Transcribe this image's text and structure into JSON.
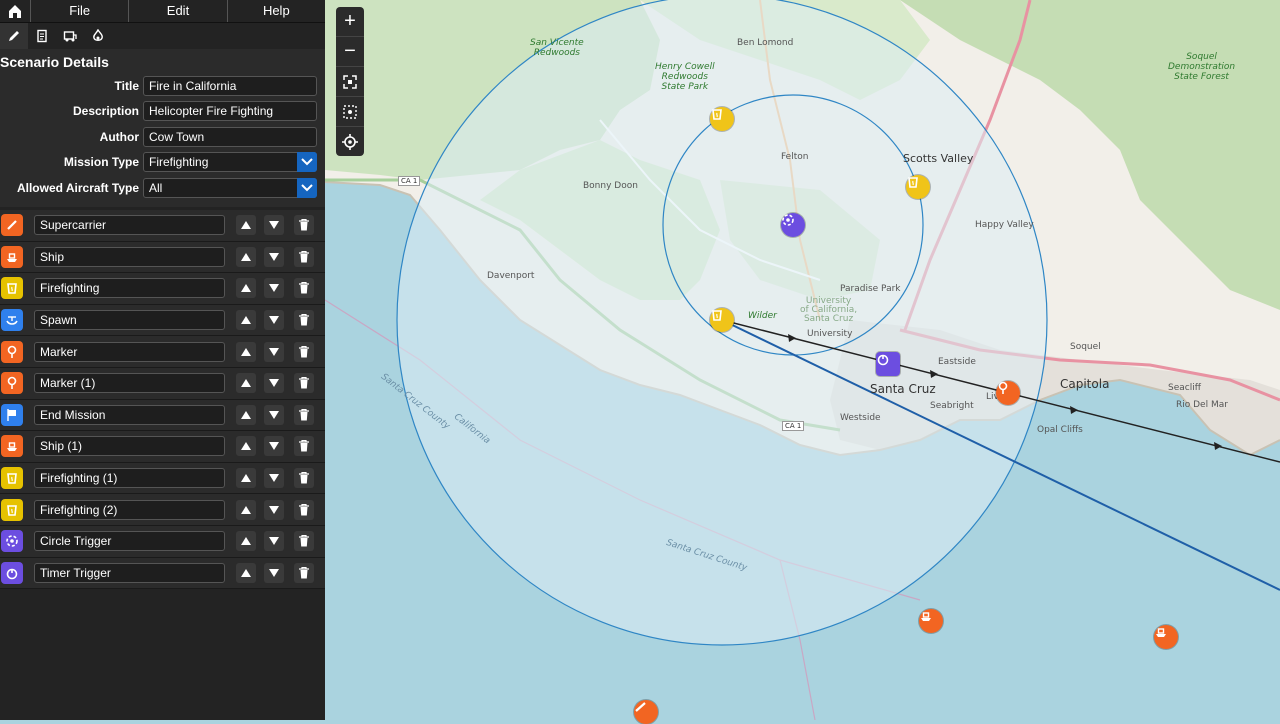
{
  "menubar": {
    "items": [
      "File",
      "Edit",
      "Help"
    ]
  },
  "tools": [
    {
      "name": "edit-tool",
      "icon": "pencil-icon"
    },
    {
      "name": "notes-tool",
      "icon": "document-icon"
    },
    {
      "name": "car-tool",
      "icon": "vehicle-icon"
    },
    {
      "name": "fire-tool",
      "icon": "fire-icon"
    }
  ],
  "scenario": {
    "heading": "Scenario Details",
    "title_label": "Title",
    "title_value": "Fire in California",
    "description_label": "Description",
    "description_value": "Helicopter Fire Fighting",
    "author_label": "Author",
    "author_value": "Cow Town",
    "mission_type_label": "Mission Type",
    "mission_type_value": "Firefighting",
    "aircraft_type_label": "Allowed Aircraft Type",
    "aircraft_type_value": "All"
  },
  "objects": [
    {
      "name": "Supercarrier",
      "color": "#f26522",
      "icon": "carrier-icon"
    },
    {
      "name": "Ship",
      "color": "#f26522",
      "icon": "ship-icon"
    },
    {
      "name": "Firefighting",
      "color": "#e6c200",
      "icon": "fire-bucket-icon"
    },
    {
      "name": "Spawn",
      "color": "#2f80ed",
      "icon": "helicopter-icon"
    },
    {
      "name": "Marker",
      "color": "#f26522",
      "icon": "pin-icon"
    },
    {
      "name": "Marker (1)",
      "color": "#f26522",
      "icon": "pin-icon"
    },
    {
      "name": "End Mission",
      "color": "#2f80ed",
      "icon": "flag-icon"
    },
    {
      "name": "Ship (1)",
      "color": "#f26522",
      "icon": "ship-icon"
    },
    {
      "name": "Firefighting (1)",
      "color": "#e6c200",
      "icon": "fire-bucket-icon"
    },
    {
      "name": "Firefighting (2)",
      "color": "#e6c200",
      "icon": "fire-bucket-icon"
    },
    {
      "name": "Circle Trigger",
      "color": "#6c4ee0",
      "icon": "circle-trigger-icon"
    },
    {
      "name": "Timer Trigger",
      "color": "#6c4ee0",
      "icon": "timer-icon"
    }
  ],
  "map_labels": {
    "ben_lomond": "Ben Lomond",
    "san_vicente": "San Vicente\nRedwoods",
    "henry_cowell": "Henry Cowell\nRedwoods\nState Park",
    "soquel_forest": "Soquel\nDemonstration\nState Forest",
    "felton": "Felton",
    "scotts_valley": "Scotts Valley",
    "bonny_doon": "Bonny Doon",
    "happy_valley": "Happy Valley",
    "davenport": "Davenport",
    "paradise_park": "Paradise Park",
    "uc_santa_cruz": "University\nof California,\nSanta Cruz",
    "university": "University",
    "wilder": "Wilder",
    "eastside": "Eastside",
    "soquel": "Soquel",
    "santa_cruz": "Santa Cruz",
    "capitola": "Capitola",
    "seacliff": "Seacliff",
    "rio_del_mar": "Rio Del Mar",
    "westside": "Westside",
    "seabright": "Seabright",
    "live_oak": "Live",
    "opal_cliffs": "Opal Cliffs",
    "ca1_north": "CA 1",
    "ca1_south": "CA 1",
    "santa_cruz_county": "Santa Cruz County",
    "california": "California",
    "santa_cruz_county_2": "Santa Cruz County"
  }
}
